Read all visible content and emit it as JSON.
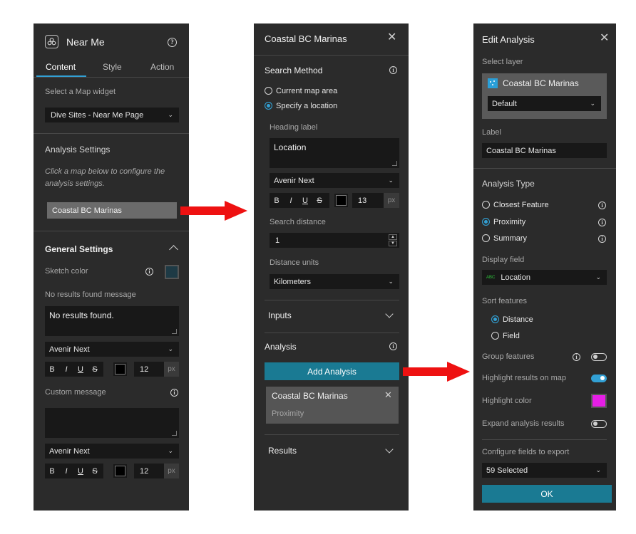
{
  "panel1": {
    "title": "Near Me",
    "tabs": [
      "Content",
      "Style",
      "Action"
    ],
    "select_map_label": "Select a Map widget",
    "map_widget_value": "Dive Sites - Near Me Page",
    "analysis_settings_title": "Analysis Settings",
    "analysis_hint": "Click a map below to configure the analysis settings.",
    "map_item": "Coastal BC Marinas",
    "general_settings_title": "General Settings",
    "sketch_color_label": "Sketch color",
    "no_results_label": "No results found message",
    "no_results_value": "No results found.",
    "font1": "Avenir Next",
    "format_buttons": [
      "B",
      "I",
      "U",
      "S"
    ],
    "font_size1": "12",
    "px_unit": "px",
    "custom_message_label": "Custom message",
    "font2": "Avenir Next",
    "font_size2": "12",
    "sketch_color": "#1e3a45"
  },
  "panel2": {
    "title": "Coastal BC Marinas",
    "search_method_title": "Search Method",
    "radio_current": "Current map area",
    "radio_specify": "Specify a location",
    "heading_label": "Heading label",
    "heading_value": "Location",
    "font": "Avenir Next",
    "format_buttons": [
      "B",
      "I",
      "U",
      "S"
    ],
    "font_size": "13",
    "px_unit": "px",
    "search_distance_label": "Search distance",
    "search_distance_value": "1",
    "distance_units_label": "Distance units",
    "distance_units_value": "Kilometers",
    "inputs_title": "Inputs",
    "analysis_title": "Analysis",
    "add_analysis_button": "Add Analysis",
    "analysis_item_title": "Coastal BC Marinas",
    "analysis_item_type": "Proximity",
    "results_title": "Results",
    "accent": "#1a7a93"
  },
  "panel3": {
    "title": "Edit Analysis",
    "select_layer_label": "Select layer",
    "layer_name": "Coastal BC Marinas",
    "layer_view": "Default",
    "label_label": "Label",
    "label_value": "Coastal BC Marinas",
    "analysis_type_title": "Analysis Type",
    "type_options": [
      "Closest Feature",
      "Proximity",
      "Summary"
    ],
    "display_field_label": "Display field",
    "display_field_type": "ABC",
    "display_field_value": "Location",
    "sort_features_label": "Sort features",
    "sort_options": [
      "Distance",
      "Field"
    ],
    "group_features_label": "Group features",
    "highlight_results_label": "Highlight results on map",
    "highlight_color_label": "Highlight color",
    "expand_results_label": "Expand analysis results",
    "configure_fields_label": "Configure fields to export",
    "fields_selected": "59 Selected",
    "ok_button": "OK",
    "highlight_color": "#e61ee6",
    "accent": "#1a7a93"
  }
}
